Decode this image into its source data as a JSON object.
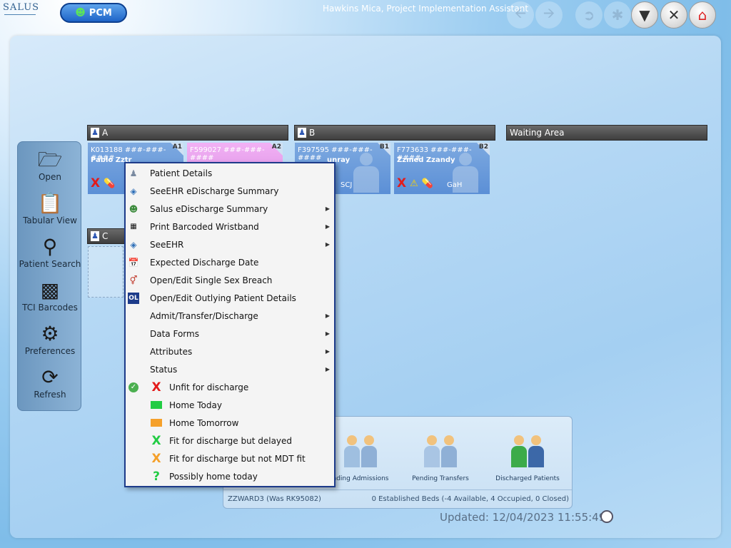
{
  "app": {
    "logo": "SALUS",
    "module_button": "PCM",
    "user_title": "Hawkins Mica, Project Implementation Assistant"
  },
  "sidebar": {
    "items": [
      {
        "label": "Open",
        "icon": "folder-icon"
      },
      {
        "label": "Tabular View",
        "icon": "clipboard-icon"
      },
      {
        "label": "Patient Search",
        "icon": "magnifier-icon"
      },
      {
        "label": "TCI Barcodes",
        "icon": "qr-code-icon"
      },
      {
        "label": "Preferences",
        "icon": "gear-icon"
      },
      {
        "label": "Refresh",
        "icon": "refresh-icon"
      }
    ]
  },
  "bays": [
    {
      "label": "A"
    },
    {
      "label": "B"
    },
    {
      "label": "Waiting Area"
    },
    {
      "label": "C"
    }
  ],
  "beds": [
    {
      "id": "K013188 ###-###-####",
      "name": "Pablo Zztr",
      "bed": "A1",
      "consultant": ""
    },
    {
      "id": "F599027 ###-###-####",
      "name": "",
      "bed": "A2",
      "consultant": ""
    },
    {
      "id": "F397595 ###-###-####",
      "name": "unray",
      "bed": "B1",
      "consultant": "SCJ"
    },
    {
      "id": "F773633 ###-###-####",
      "name": "Zzmed Zzandy",
      "bed": "B2",
      "consultant": "GaH"
    }
  ],
  "context_menu": {
    "items": [
      {
        "label": "Patient Details",
        "icon": "patient-icon",
        "submenu": false
      },
      {
        "label": "SeeEHR eDischarge Summary",
        "icon": "seeehr-icon",
        "submenu": false
      },
      {
        "label": "Salus eDischarge Summary",
        "icon": "salus-icon",
        "submenu": true
      },
      {
        "label": "Print Barcoded Wristband",
        "icon": "barcode-icon",
        "submenu": true
      },
      {
        "label": "SeeEHR",
        "icon": "seeehr-icon",
        "submenu": true
      },
      {
        "label": "Expected Discharge Date",
        "icon": "calendar-icon",
        "submenu": false
      },
      {
        "label": "Open/Edit Single Sex Breach",
        "icon": "gender-icon",
        "submenu": false
      },
      {
        "label": "Open/Edit Outlying Patient Details",
        "icon": "outlier-icon",
        "icon_text": "OL",
        "submenu": false
      },
      {
        "label": "Admit/Transfer/Discharge",
        "submenu": true
      },
      {
        "label": "Data Forms",
        "submenu": true
      },
      {
        "label": "Attributes",
        "submenu": true
      },
      {
        "label": "Status",
        "submenu": true
      }
    ],
    "status_items": [
      {
        "label": "Unfit for discharge",
        "glyph": "X",
        "color": "#e31b1b",
        "checked": true
      },
      {
        "label": "Home Today",
        "glyph": "",
        "color": "#22cc44",
        "swatch": true
      },
      {
        "label": "Home Tomorrow",
        "glyph": "",
        "color": "#f5a02a",
        "swatch": true
      },
      {
        "label": "Fit for discharge but delayed",
        "glyph": "X",
        "color": "#22cc44"
      },
      {
        "label": "Fit for discharge but not MDT fit",
        "glyph": "X",
        "color": "#f5a02a"
      },
      {
        "label": "Possibly home today",
        "glyph": "?",
        "color": "#22cc44"
      }
    ]
  },
  "bottom_panel": {
    "items": [
      {
        "label": "nding Admissions"
      },
      {
        "label": "Pending Transfers"
      },
      {
        "label": "Discharged Patients"
      }
    ],
    "ward": "ZZWARD3 (Was RK95082)",
    "beds_summary": "0 Established Beds (-4 Available, 4 Occupied, 0 Closed)"
  },
  "updated": "Updated: 12/04/2023 11:55:49"
}
